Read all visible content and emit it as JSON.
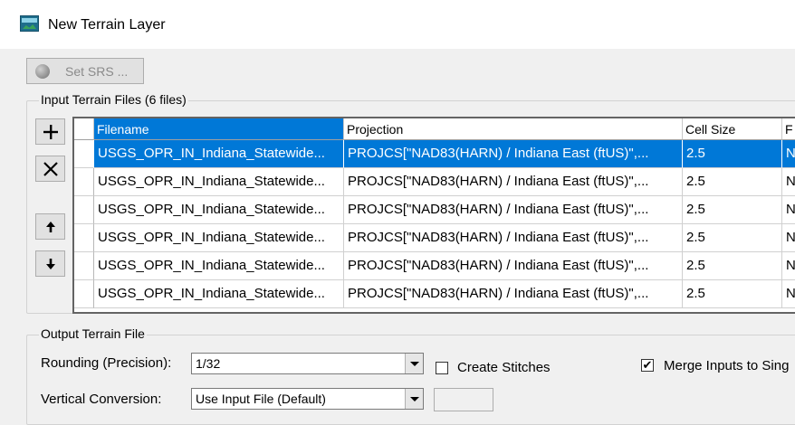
{
  "window": {
    "title": "New Terrain Layer"
  },
  "toolbar": {
    "set_srs_label": "Set SRS ..."
  },
  "input_group": {
    "legend": "Input Terrain Files (6 files)",
    "buttons": {
      "add": "+",
      "remove": "×",
      "move_up": "↑",
      "move_down": "↓"
    },
    "columns": [
      "Filename",
      "Projection",
      "Cell Size",
      "F"
    ],
    "rows": [
      [
        "USGS_OPR_IN_Indiana_Statewide...",
        "PROJCS[\"NAD83(HARN) / Indiana East (ftUS)\",...",
        "2.5",
        "N"
      ],
      [
        "USGS_OPR_IN_Indiana_Statewide...",
        "PROJCS[\"NAD83(HARN) / Indiana East (ftUS)\",...",
        "2.5",
        "N"
      ],
      [
        "USGS_OPR_IN_Indiana_Statewide...",
        "PROJCS[\"NAD83(HARN) / Indiana East (ftUS)\",...",
        "2.5",
        "N"
      ],
      [
        "USGS_OPR_IN_Indiana_Statewide...",
        "PROJCS[\"NAD83(HARN) / Indiana East (ftUS)\",...",
        "2.5",
        "N"
      ],
      [
        "USGS_OPR_IN_Indiana_Statewide...",
        "PROJCS[\"NAD83(HARN) / Indiana East (ftUS)\",...",
        "2.5",
        "N"
      ],
      [
        "USGS_OPR_IN_Indiana_Statewide...",
        "PROJCS[\"NAD83(HARN) / Indiana East (ftUS)\",...",
        "2.5",
        "N"
      ]
    ],
    "selected_row": 0
  },
  "output_group": {
    "legend": "Output Terrain File",
    "rounding_label": "Rounding (Precision):",
    "rounding_value": "1/32",
    "create_stitches_label": "Create Stitches",
    "create_stitches_checked": "",
    "merge_inputs_label": "Merge Inputs to Sing",
    "merge_inputs_checked": "✔",
    "vertical_conversion_label": "Vertical Conversion:",
    "vertical_conversion_value": "Use Input File (Default)"
  },
  "colors": {
    "selection": "#0078d7",
    "window_bg": "#f0f0f0"
  },
  "icons": {
    "app": "terrain-layer-icon",
    "srs": "globe-icon"
  }
}
